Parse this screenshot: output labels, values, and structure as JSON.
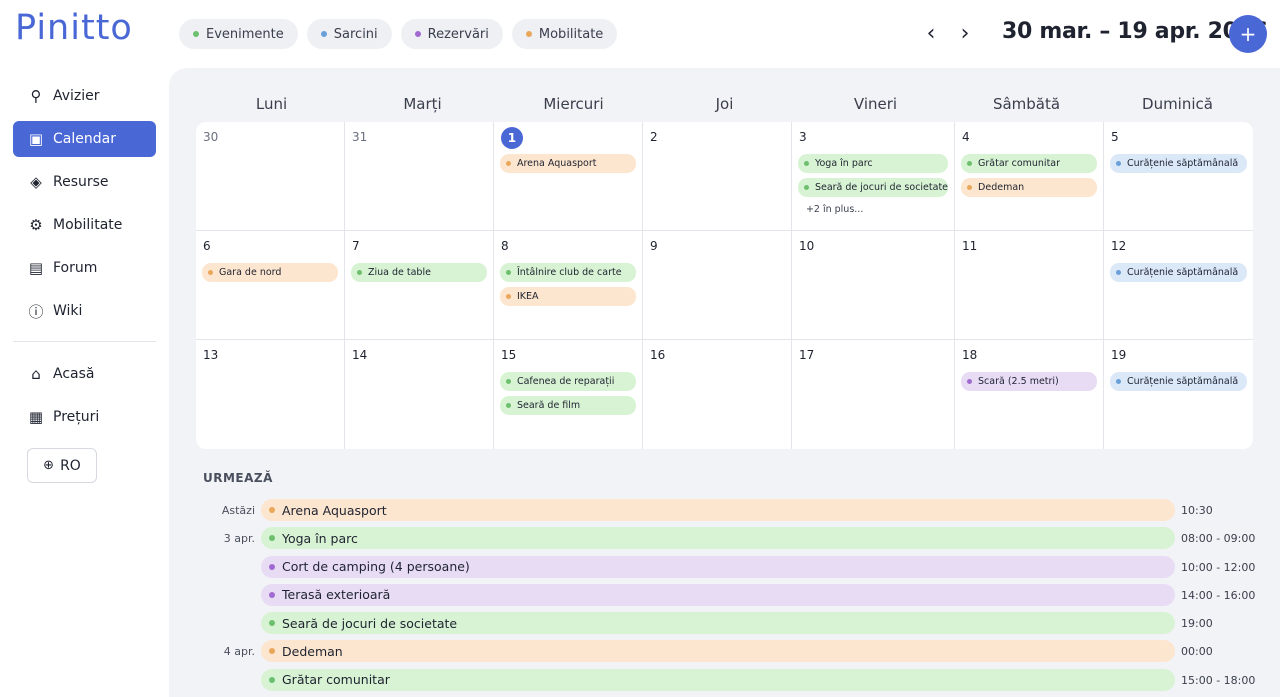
{
  "app": {
    "logo": "Pinitto"
  },
  "colors": {
    "accent": "#4a67d6",
    "event": "#e9a75c",
    "task": "#6cbf6c",
    "booking": "#a06ad0",
    "mobility": "#e9a75c"
  },
  "filters": [
    {
      "label": "Evenimente",
      "dot": "#6cbf6c"
    },
    {
      "label": "Sarcini",
      "dot": "#6a9fd8"
    },
    {
      "label": "Rezervări",
      "dot": "#a06ad0"
    },
    {
      "label": "Mobilitate",
      "dot": "#e9a75c"
    }
  ],
  "header": {
    "range": "30 mar. – 19 apr. 2026",
    "prev_icon": "chevron-left-icon",
    "next_icon": "chevron-right-icon",
    "add_icon": "plus-icon"
  },
  "sidebar": {
    "items": [
      {
        "label": "Avizier",
        "icon": "pin-icon",
        "glyph": "⚲"
      },
      {
        "label": "Calendar",
        "icon": "calendar-icon",
        "glyph": "▣",
        "active": true
      },
      {
        "label": "Resurse",
        "icon": "tag-icon",
        "glyph": "◈"
      },
      {
        "label": "Mobilitate",
        "icon": "bike-icon",
        "glyph": "⚙"
      },
      {
        "label": "Forum",
        "icon": "forum-icon",
        "glyph": "▤"
      },
      {
        "label": "Wiki",
        "icon": "info-icon",
        "glyph": "ⓘ"
      }
    ],
    "secondary": [
      {
        "label": "Acasă",
        "icon": "home-icon",
        "glyph": "⌂"
      },
      {
        "label": "Prețuri",
        "icon": "pricing-icon",
        "glyph": "▦"
      }
    ],
    "lang": {
      "label": "RO",
      "icon": "globe-icon"
    }
  },
  "calendar": {
    "weekdays": [
      "Luni",
      "Marți",
      "Miercuri",
      "Joi",
      "Vineri",
      "Sâmbătă",
      "Duminică"
    ],
    "days": [
      {
        "num": "30",
        "muted": true,
        "events": []
      },
      {
        "num": "31",
        "muted": true,
        "events": []
      },
      {
        "num": "1",
        "today": true,
        "events": [
          {
            "label": "Arena Aquasport",
            "type": "mobility"
          }
        ]
      },
      {
        "num": "2",
        "events": []
      },
      {
        "num": "3",
        "events": [
          {
            "label": "Yoga în parc",
            "type": "task"
          },
          {
            "label": "Seară de jocuri de societate",
            "type": "task"
          }
        ],
        "more": "+2 în plus..."
      },
      {
        "num": "4",
        "events": [
          {
            "label": "Grătar comunitar",
            "type": "task"
          },
          {
            "label": "Dedeman",
            "type": "mobility"
          }
        ]
      },
      {
        "num": "5",
        "events": [
          {
            "label": "Curățenie săptămânală",
            "type": "blue"
          }
        ]
      },
      {
        "num": "6",
        "events": [
          {
            "label": "Gara de nord",
            "type": "mobility"
          }
        ]
      },
      {
        "num": "7",
        "events": [
          {
            "label": "Ziua de table",
            "type": "task"
          }
        ]
      },
      {
        "num": "8",
        "events": [
          {
            "label": "Întâlnire club de carte",
            "type": "task"
          },
          {
            "label": "IKEA",
            "type": "mobility"
          }
        ]
      },
      {
        "num": "9",
        "events": []
      },
      {
        "num": "10",
        "events": []
      },
      {
        "num": "11",
        "events": []
      },
      {
        "num": "12",
        "events": [
          {
            "label": "Curățenie săptămânală",
            "type": "blue"
          }
        ]
      },
      {
        "num": "13",
        "events": []
      },
      {
        "num": "14",
        "events": []
      },
      {
        "num": "15",
        "events": [
          {
            "label": "Cafenea de reparații",
            "type": "task"
          },
          {
            "label": "Seară de film",
            "type": "task"
          }
        ]
      },
      {
        "num": "16",
        "events": []
      },
      {
        "num": "17",
        "events": []
      },
      {
        "num": "18",
        "events": [
          {
            "label": "Scară (2.5 metri)",
            "type": "booking"
          }
        ]
      },
      {
        "num": "19",
        "events": [
          {
            "label": "Curățenie săptămânală",
            "type": "blue"
          }
        ]
      }
    ]
  },
  "upcoming": {
    "title": "URMEAZĂ",
    "rows": [
      {
        "date": "Astăzi",
        "label": "Arena Aquasport",
        "type": "mobility",
        "time": "10:30"
      },
      {
        "date": "3 apr.",
        "label": "Yoga în parc",
        "type": "task",
        "time": "08:00 - 09:00"
      },
      {
        "date": "",
        "label": "Cort de camping (4 persoane)",
        "type": "booking",
        "time": "10:00 - 12:00"
      },
      {
        "date": "",
        "label": "Terasă exterioară",
        "type": "booking",
        "time": "14:00 - 16:00"
      },
      {
        "date": "",
        "label": "Seară de jocuri de societate",
        "type": "task",
        "time": "19:00"
      },
      {
        "date": "4 apr.",
        "label": "Dedeman",
        "type": "mobility",
        "time": "00:00"
      },
      {
        "date": "",
        "label": "Grătar comunitar",
        "type": "task",
        "time": "15:00 - 18:00"
      }
    ]
  },
  "type_styles": {
    "mobility": {
      "bg": "#fde6cf",
      "dot": "#e9a75c"
    },
    "task": {
      "bg": "#d8f3d4",
      "dot": "#6cbf6c"
    },
    "booking": {
      "bg": "#e8dcf5",
      "dot": "#a06ad0"
    },
    "blue": {
      "bg": "#dbe8f8",
      "dot": "#6a9fd8"
    }
  }
}
